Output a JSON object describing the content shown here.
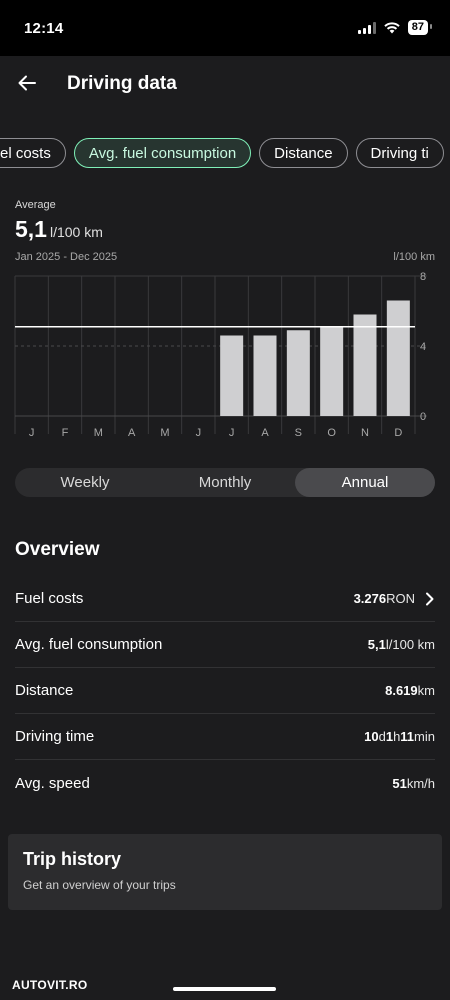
{
  "status": {
    "time": "12:14",
    "battery": "87"
  },
  "header": {
    "title": "Driving data"
  },
  "chips": [
    "el costs",
    "Avg. fuel consumption",
    "Distance",
    "Driving ti"
  ],
  "average": {
    "label": "Average",
    "value": "5,1",
    "unit": "l/100 km",
    "range": "Jan 2025 - Dec 2025"
  },
  "chart_data": {
    "type": "bar",
    "unit_label": "l/100 km",
    "categories": [
      "J",
      "F",
      "M",
      "A",
      "M",
      "J",
      "J",
      "A",
      "S",
      "O",
      "N",
      "D"
    ],
    "values": [
      null,
      null,
      null,
      null,
      null,
      null,
      4.6,
      4.6,
      4.9,
      5.1,
      5.8,
      6.6
    ],
    "average": 5.1,
    "ylim": [
      0,
      8
    ],
    "yticks": [
      "8",
      "4",
      "0"
    ],
    "grid": true
  },
  "segmented": {
    "options": [
      "Weekly",
      "Monthly",
      "Annual"
    ],
    "selected": "Annual"
  },
  "overview": {
    "title": "Overview",
    "rows": [
      {
        "label": "Fuel costs",
        "parts": [
          {
            "b": true,
            "t": "3.276"
          },
          {
            "t": " RON"
          }
        ],
        "chevron": true
      },
      {
        "label": "Avg. fuel consumption",
        "parts": [
          {
            "b": true,
            "t": "5,1"
          },
          {
            "t": " l/100 km"
          }
        ]
      },
      {
        "label": "Distance",
        "parts": [
          {
            "b": true,
            "t": "8.619"
          },
          {
            "t": " km"
          }
        ]
      },
      {
        "label": "Driving time",
        "parts": [
          {
            "b": true,
            "t": "10"
          },
          {
            "t": " d "
          },
          {
            "b": true,
            "t": "1"
          },
          {
            "t": " h "
          },
          {
            "b": true,
            "t": "11"
          },
          {
            "t": " min"
          }
        ]
      },
      {
        "label": "Avg. speed",
        "parts": [
          {
            "b": true,
            "t": "51"
          },
          {
            "t": " km/h"
          }
        ]
      }
    ]
  },
  "trip_history": {
    "title": "Trip history",
    "subtitle": "Get an overview of your trips"
  },
  "watermark": "AUTOVIT.RO",
  "colors": {
    "accent": "#7ff0b8",
    "background": "#1c1c1e",
    "card": "#2c2c2e",
    "bar": "#cfcfd1"
  }
}
